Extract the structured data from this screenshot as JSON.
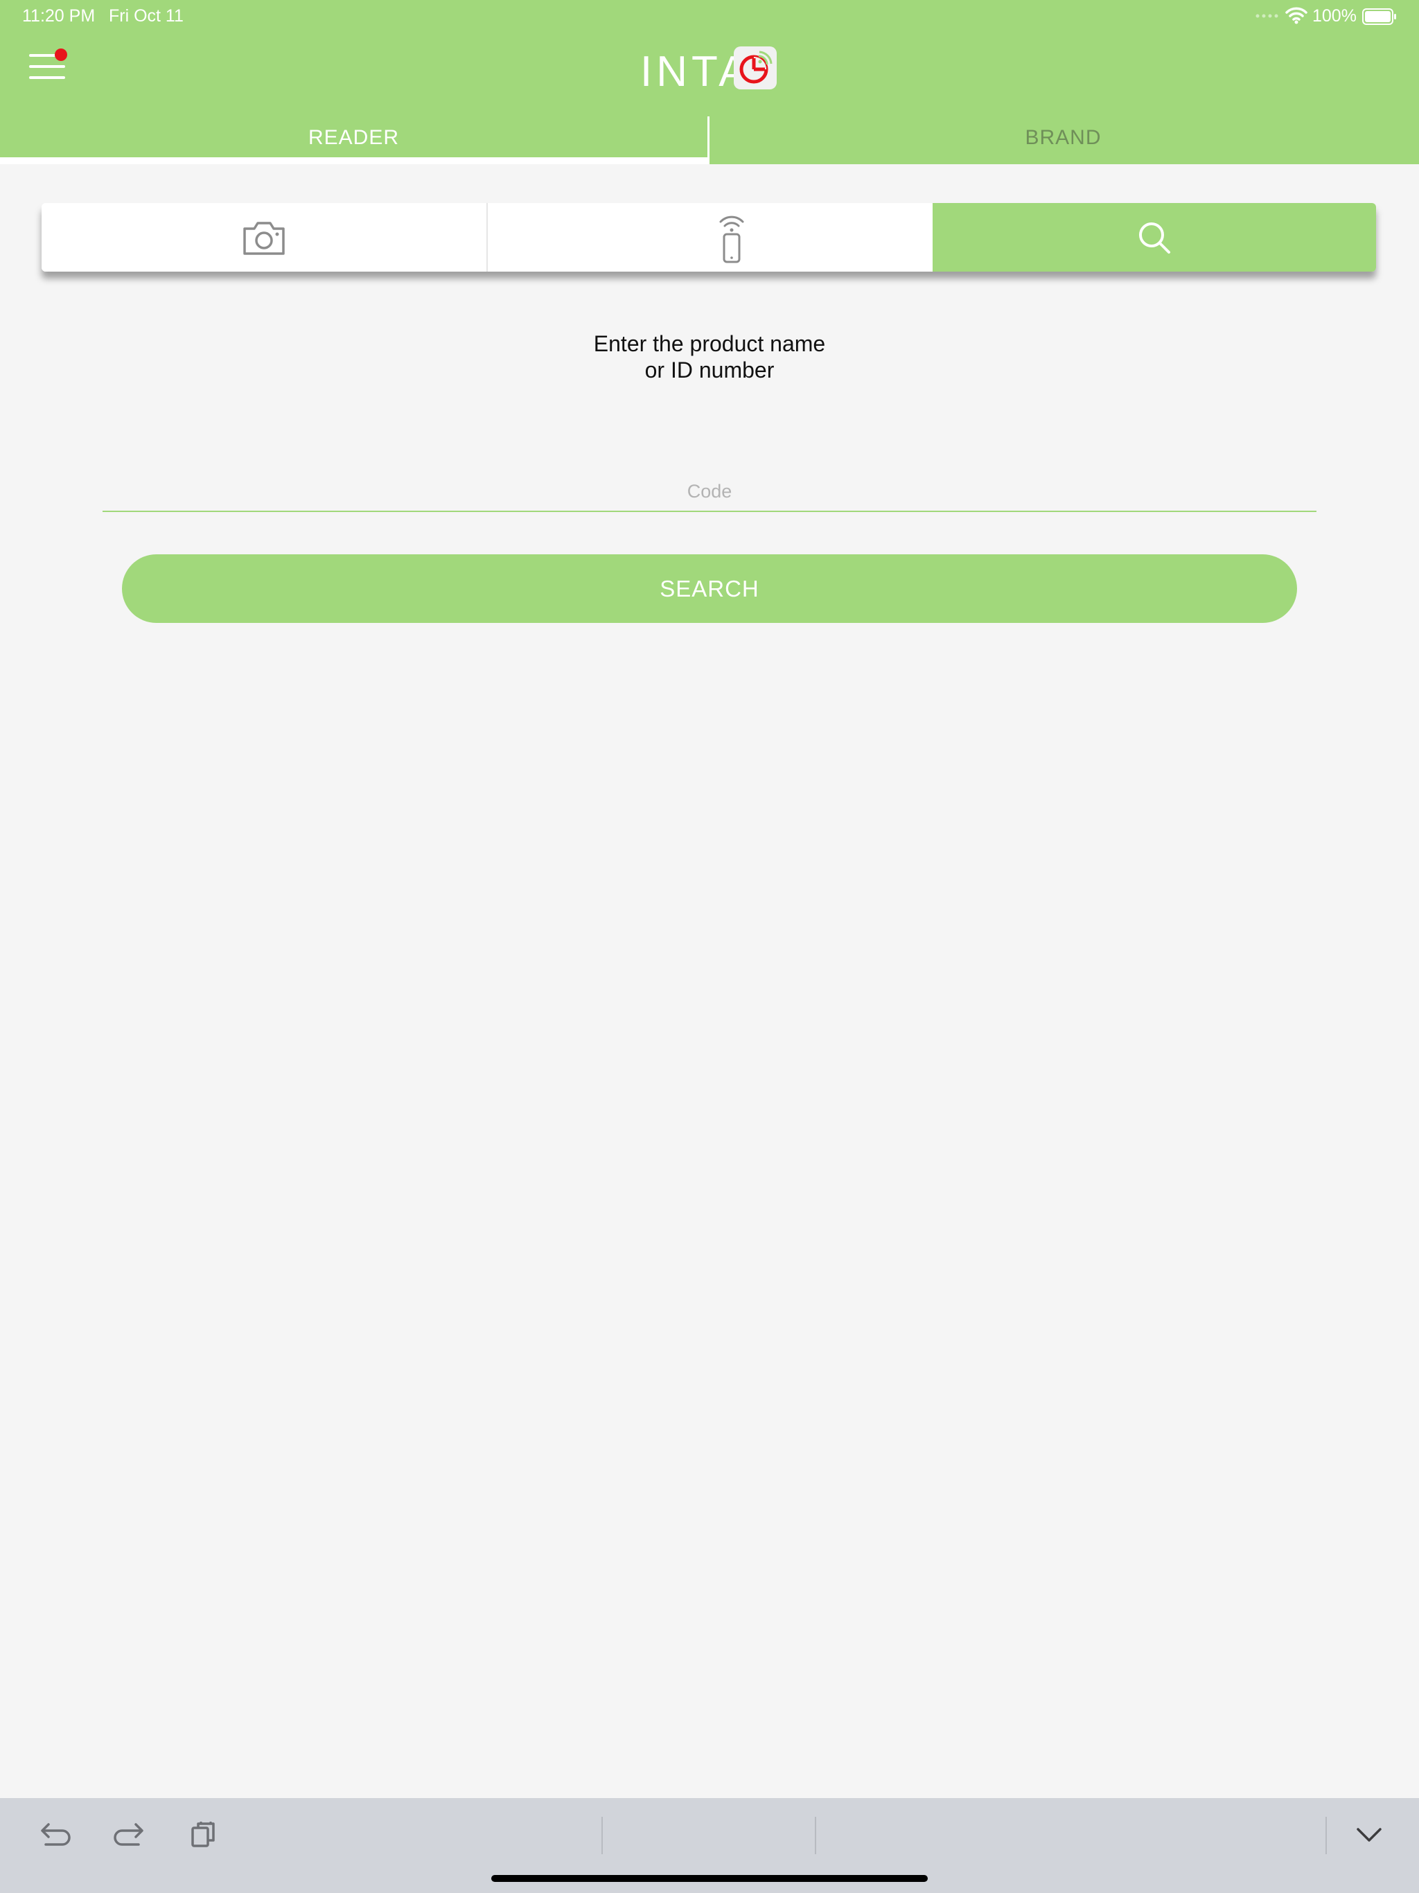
{
  "status_bar": {
    "time": "11:20 PM",
    "date": "Fri Oct 11",
    "battery": "100%"
  },
  "app": {
    "logo_text": "INTA",
    "accent_color": "#a1d87b",
    "notification_color": "#e8141b"
  },
  "tabs": [
    {
      "label": "READER",
      "selected": true
    },
    {
      "label": "BRAND",
      "selected": false
    }
  ],
  "modes": [
    {
      "icon": "camera-icon",
      "selected": false
    },
    {
      "icon": "nfc-phone-icon",
      "selected": false
    },
    {
      "icon": "search-icon",
      "selected": true
    }
  ],
  "search": {
    "instruction_line1": "Enter the product name",
    "instruction_line2": "or ID number",
    "placeholder": "Code",
    "value": "",
    "button_label": "SEARCH"
  },
  "keyboard_bar": {
    "icons": [
      "undo-icon",
      "redo-icon",
      "paste-icon",
      "hide-keyboard-icon"
    ]
  }
}
